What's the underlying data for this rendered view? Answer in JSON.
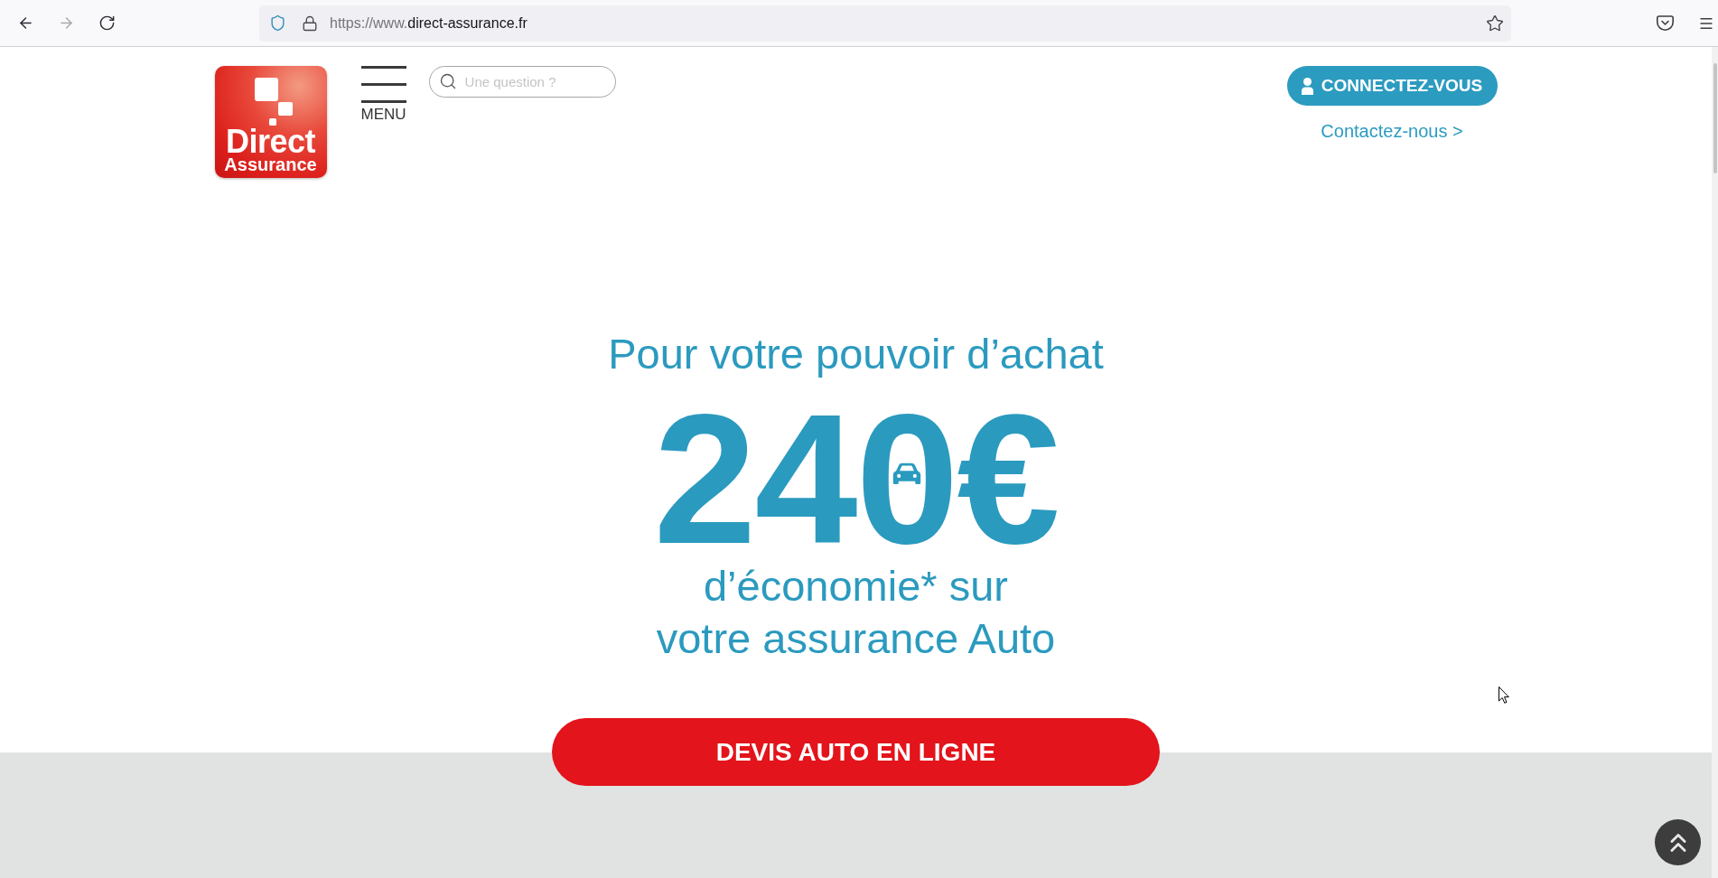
{
  "browser": {
    "nav_buttons": [
      {
        "kind": "back",
        "disabled": false
      },
      {
        "kind": "forward",
        "disabled": true
      },
      {
        "kind": "reload",
        "disabled": false
      }
    ],
    "url": {
      "prefix": "https://www.",
      "domain": "direct-assurance.fr"
    }
  },
  "header": {
    "logo": {
      "line_1": "Direct",
      "line_2": "Assurance"
    },
    "menu_label": "MENU",
    "search": {
      "placeholder": "Une question ?"
    },
    "login_button": "CONNECTEZ-VOUS",
    "contact_link": "Contactez-nous >"
  },
  "hero": {
    "title": "Pour votre pouvoir d’achat",
    "amount": "240€",
    "subtitle_lines": [
      "d’économie* sur",
      "votre assurance Auto"
    ],
    "cta_button": "DEVIS AUTO EN LIGNE"
  }
}
